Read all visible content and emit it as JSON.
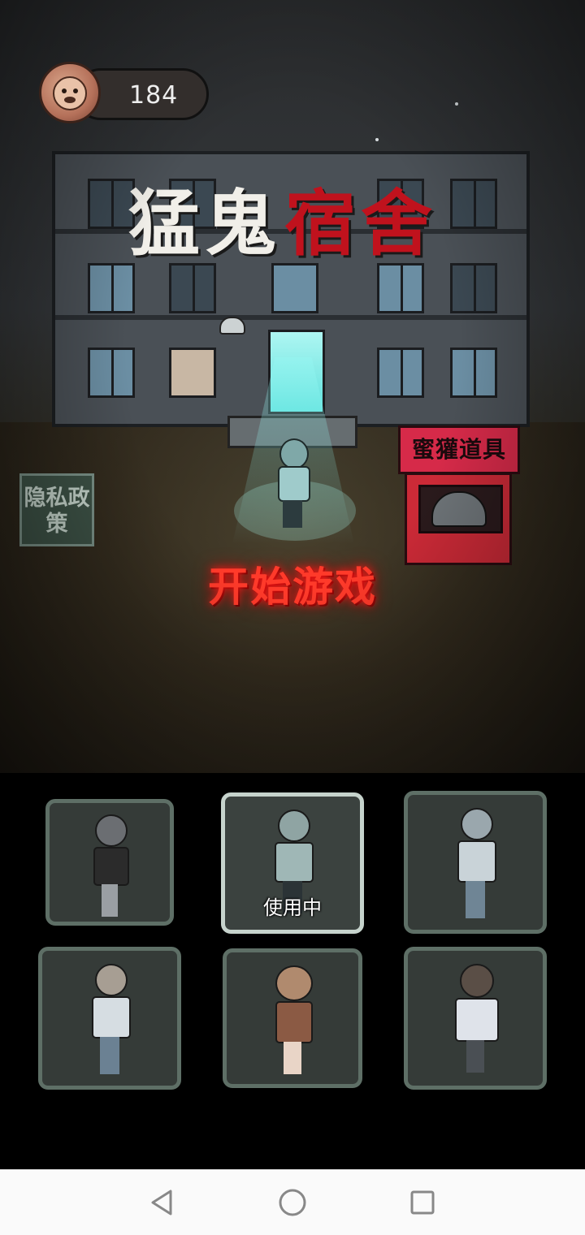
{
  "header": {
    "coins": "184",
    "coin_icon": "badger-coin-icon"
  },
  "title": {
    "part1": "猛鬼",
    "part2": "宿舍"
  },
  "buttons": {
    "privacy": "隐私政策",
    "shop": "蜜獾道具",
    "start": "开始游戏"
  },
  "characters": {
    "items": [
      {
        "name": "girl-black-dress",
        "selected": false
      },
      {
        "name": "boy-hoodie",
        "selected": true,
        "status": "使用中"
      },
      {
        "name": "boy-tracksuit",
        "selected": false
      },
      {
        "name": "girl-ponytail-tracksuit",
        "selected": false
      },
      {
        "name": "girl-pigtails-apron",
        "selected": false
      },
      {
        "name": "girl-sailor-uniform",
        "selected": false
      }
    ]
  },
  "navbar": {
    "back": "back-icon",
    "home": "home-icon",
    "recent": "recent-apps-icon"
  },
  "colors": {
    "title_red": "#c0121d",
    "start_red": "#ff3a2a",
    "shop_red": "#d62a49",
    "card_border": "#5e6f66",
    "card_selected": "#c6d3cc"
  }
}
